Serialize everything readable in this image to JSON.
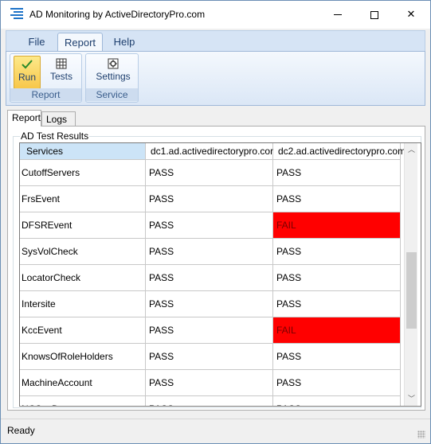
{
  "window": {
    "title": "AD Monitoring by ActiveDirectoryPro.com",
    "min_icon": "minimize-icon",
    "max_icon": "maximize-icon",
    "close_icon": "close-icon"
  },
  "menu": {
    "tabs": [
      {
        "label": "File",
        "active": false
      },
      {
        "label": "Report",
        "active": true
      },
      {
        "label": "Help",
        "active": false
      }
    ]
  },
  "ribbon": {
    "groups": [
      {
        "label": "Report",
        "buttons": [
          {
            "label": "Run",
            "icon": "checkmark-icon",
            "highlighted": true
          },
          {
            "label": "Tests",
            "icon": "grid-icon",
            "highlighted": false
          }
        ]
      },
      {
        "label": "Service",
        "buttons": [
          {
            "label": "Settings",
            "icon": "settings-icon",
            "highlighted": false
          }
        ]
      }
    ]
  },
  "tabs": [
    {
      "label": "Report",
      "active": true
    },
    {
      "label": "Logs",
      "active": false
    }
  ],
  "results": {
    "group_title": "AD Test Results",
    "columns": [
      "Services",
      "dc1.ad.activedirectorypro.com",
      "dc2.ad.activedirectorypro.com"
    ],
    "rows": [
      [
        "CutoffServers",
        "PASS",
        "PASS"
      ],
      [
        "FrsEvent",
        "PASS",
        "PASS"
      ],
      [
        "DFSREvent",
        "PASS",
        "FAIL"
      ],
      [
        "SysVolCheck",
        "PASS",
        "PASS"
      ],
      [
        "LocatorCheck",
        "PASS",
        "PASS"
      ],
      [
        "Intersite",
        "PASS",
        "PASS"
      ],
      [
        "KccEvent",
        "PASS",
        "FAIL"
      ],
      [
        "KnowsOfRoleHolders",
        "PASS",
        "PASS"
      ],
      [
        "MachineAccount",
        "PASS",
        "PASS"
      ],
      [
        "NCSecDesc",
        "PASS",
        "PASS"
      ]
    ],
    "fail_color": "#ff0000",
    "scroll_up_icon": "chevron-up-icon",
    "scroll_down_icon": "chevron-down-icon"
  },
  "status": {
    "text": "Ready"
  },
  "colors": {
    "accent": "#1e73c8",
    "ribbon_text": "#1e3f6e",
    "selected_header": "#cce4f7"
  }
}
